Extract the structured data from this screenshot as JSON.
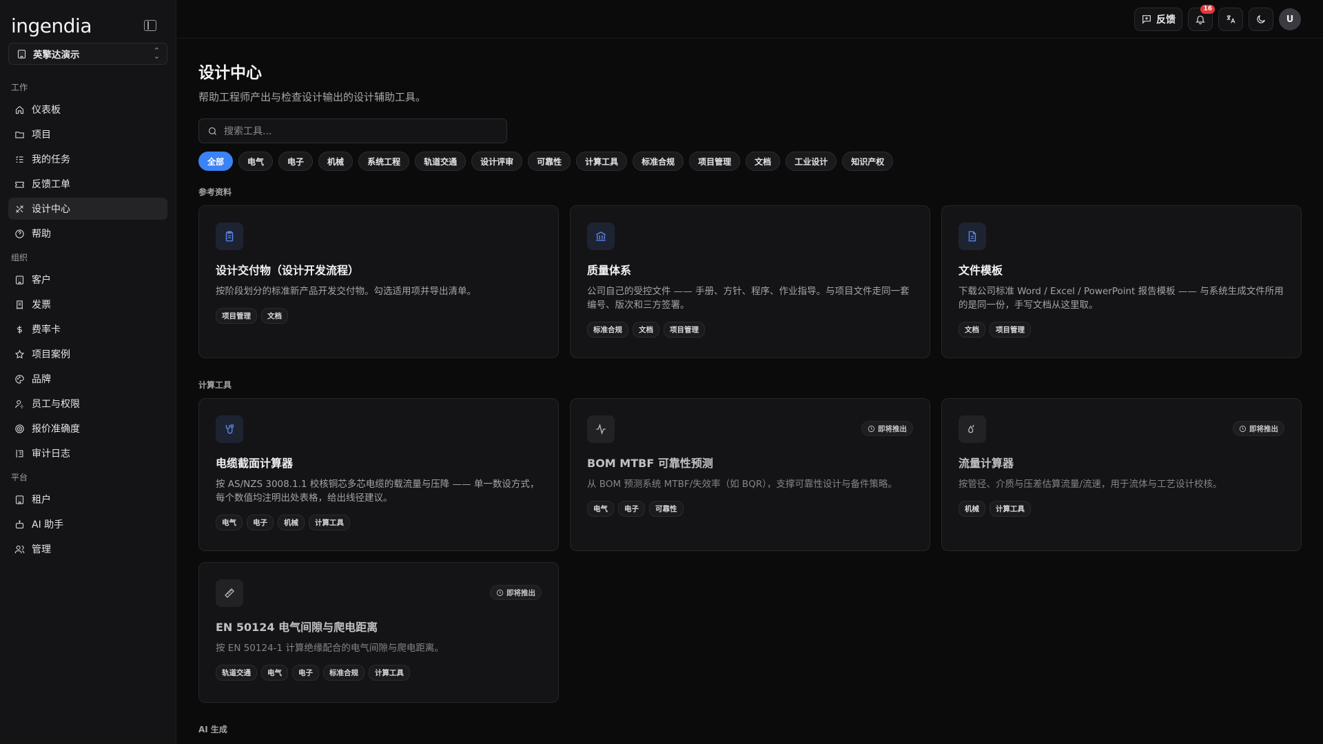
{
  "app": {
    "logo": "ingendia",
    "org_name": "英擎达演示"
  },
  "sidebar": {
    "sections": [
      {
        "label": "工作",
        "items": [
          {
            "label": "仪表板",
            "icon": "home-icon"
          },
          {
            "label": "项目",
            "icon": "folder-icon"
          },
          {
            "label": "我的任务",
            "icon": "list-check-icon"
          },
          {
            "label": "反馈工单",
            "icon": "ticket-icon"
          },
          {
            "label": "设计中心",
            "icon": "design-tools-icon",
            "active": true
          },
          {
            "label": "帮助",
            "icon": "help-circle-icon"
          }
        ]
      },
      {
        "label": "组织",
        "items": [
          {
            "label": "客户",
            "icon": "building-icon"
          },
          {
            "label": "发票",
            "icon": "invoice-icon"
          },
          {
            "label": "费率卡",
            "icon": "dollar-icon"
          },
          {
            "label": "项目案例",
            "icon": "star-icon"
          },
          {
            "label": "品牌",
            "icon": "palette-icon"
          },
          {
            "label": "员工与权限",
            "icon": "user-cog-icon"
          },
          {
            "label": "报价准确度",
            "icon": "target-icon"
          },
          {
            "label": "审计日志",
            "icon": "log-icon"
          }
        ]
      },
      {
        "label": "平台",
        "items": [
          {
            "label": "租户",
            "icon": "building-icon"
          },
          {
            "label": "AI 助手",
            "icon": "bot-icon"
          },
          {
            "label": "管理",
            "icon": "users-icon"
          }
        ]
      }
    ]
  },
  "topbar": {
    "feedback_label": "反馈",
    "notification_count": "16",
    "avatar_initial": "U"
  },
  "page": {
    "title": "设计中心",
    "subtitle": "帮助工程师产出与检查设计输出的设计辅助工具。",
    "search_placeholder": "搜索工具...",
    "filters": [
      "全部",
      "电气",
      "电子",
      "机械",
      "系统工程",
      "轨道交通",
      "设计评审",
      "可靠性",
      "计算工具",
      "标准合规",
      "项目管理",
      "文档",
      "工业设计",
      "知识产权"
    ],
    "active_filter": "全部"
  },
  "groups": [
    {
      "label": "参考资料",
      "cards": [
        {
          "title": "设计交付物（设计开发流程）",
          "desc": "按阶段划分的标准新产品开发交付物。勾选适用项并导出清单。",
          "tags": [
            "项目管理",
            "文档"
          ],
          "icon": "clipboard-icon",
          "soon": ""
        },
        {
          "title": "质量体系",
          "desc": "公司自己的受控文件 —— 手册、方针、程序、作业指导。与项目文件走同一套编号、版次和三方签署。",
          "tags": [
            "标准合规",
            "文档",
            "项目管理"
          ],
          "icon": "bank-icon",
          "soon": ""
        },
        {
          "title": "文件模板",
          "desc": "下载公司标准 Word / Excel / PowerPoint 报告模板 —— 与系统生成文件所用的是同一份，手写文档从这里取。",
          "tags": [
            "文档",
            "项目管理"
          ],
          "icon": "file-text-icon",
          "soon": ""
        }
      ]
    },
    {
      "label": "计算工具",
      "cards": [
        {
          "title": "电缆截面计算器",
          "desc": "按 AS/NZS 3008.1.1 校核铜芯多芯电缆的载流量与压降 —— 单一数设方式，每个数值均注明出处表格，给出线径建议。",
          "tags": [
            "电气",
            "电子",
            "机械",
            "计算工具"
          ],
          "icon": "cable-icon",
          "soon": ""
        },
        {
          "title": "BOM MTBF 可靠性预测",
          "desc": "从 BOM 预测系统 MTBF/失效率（如 BQR），支撑可靠性设计与备件策略。",
          "tags": [
            "电气",
            "电子",
            "可靠性"
          ],
          "icon": "activity-icon",
          "soon": "即将推出"
        },
        {
          "title": "流量计算器",
          "desc": "按管径、介质与压差估算流量/流速，用于流体与工艺设计校核。",
          "tags": [
            "机械",
            "计算工具"
          ],
          "icon": "droplets-icon",
          "soon": "即将推出"
        },
        {
          "title": "EN 50124 电气间隙与爬电距离",
          "desc": "按 EN 50124-1 计算绝缘配合的电气间隙与爬电距离。",
          "tags": [
            "轨道交通",
            "电气",
            "电子",
            "标准合规",
            "计算工具"
          ],
          "icon": "ruler-icon",
          "soon": "即将推出"
        }
      ]
    },
    {
      "label": "AI 生成",
      "cards": []
    }
  ]
}
